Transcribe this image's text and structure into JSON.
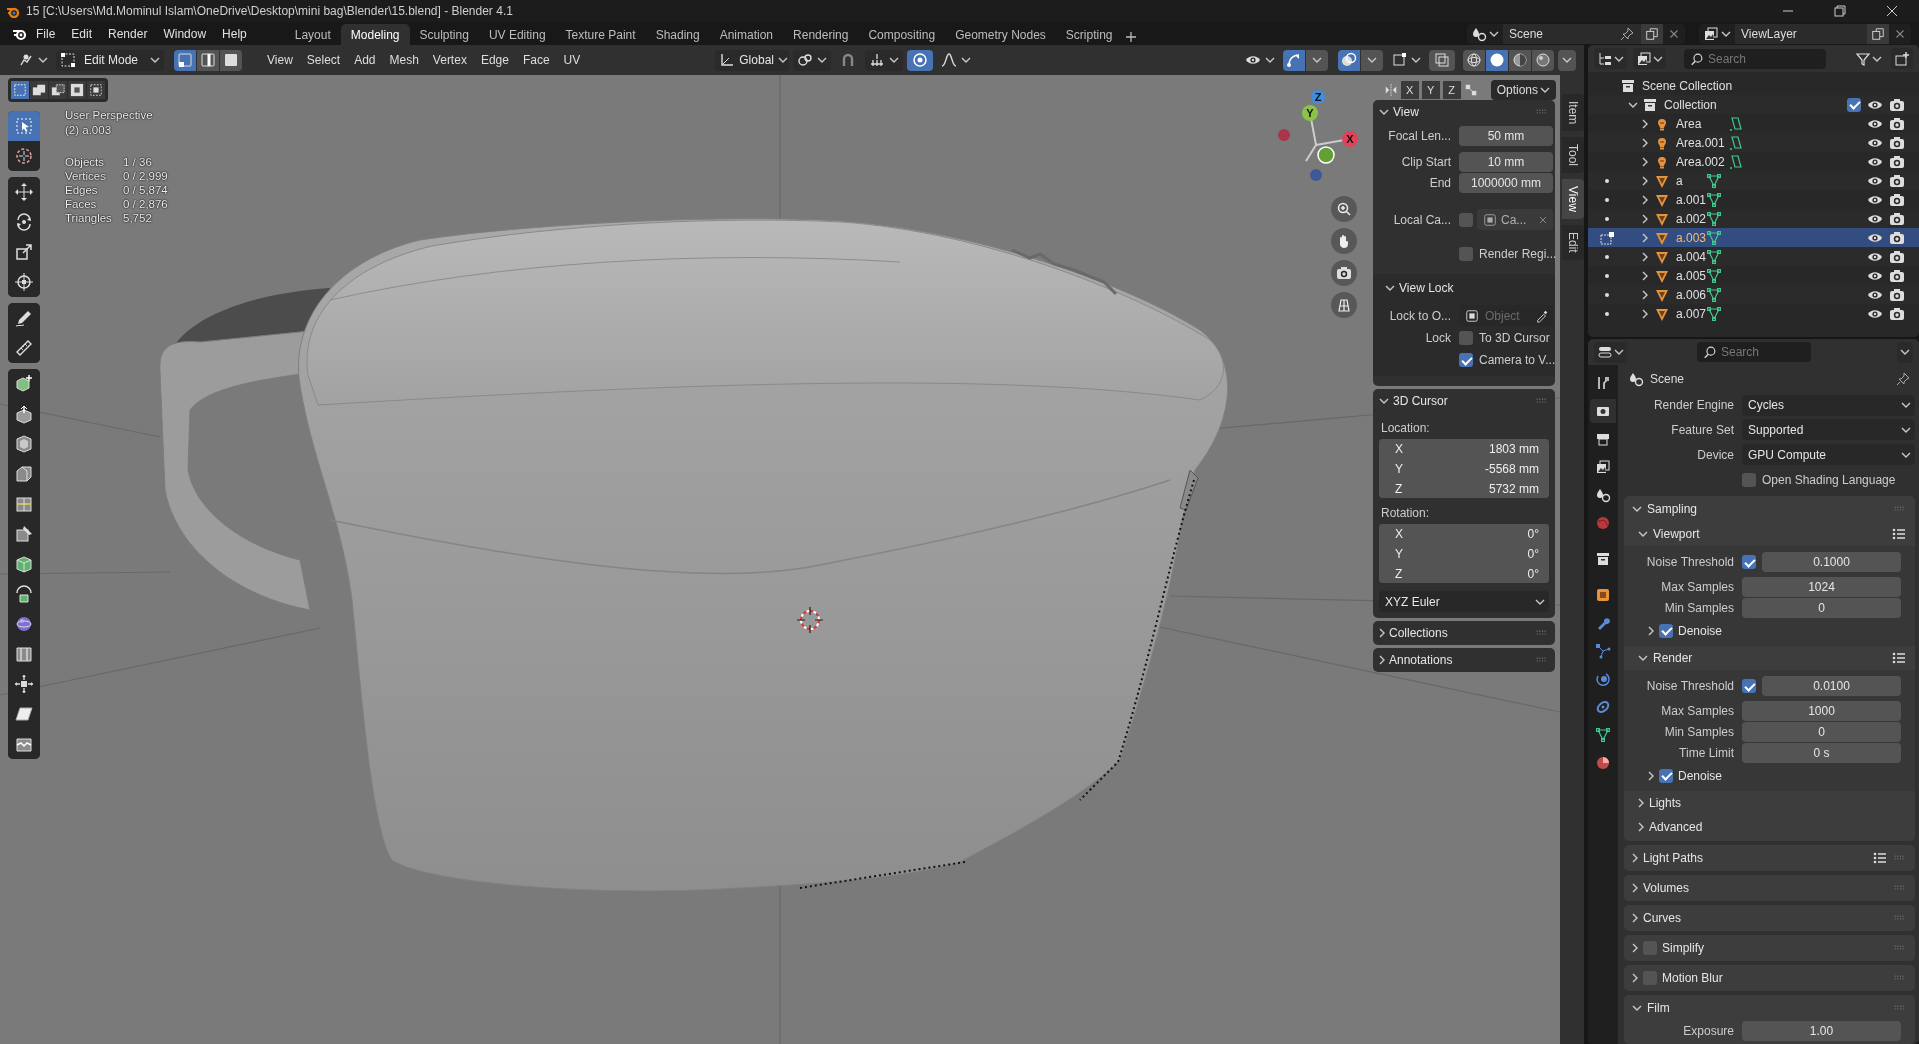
{
  "title_bar": {
    "title": "15 [C:\\Users\\Md.Mominul Islam\\OneDrive\\Desktop\\mini bag\\Blender\\15.blend] - Blender 4.1"
  },
  "menu": [
    "File",
    "Edit",
    "Render",
    "Window",
    "Help"
  ],
  "workspaces": [
    {
      "label": "Layout",
      "selected": false
    },
    {
      "label": "Modeling",
      "selected": true
    },
    {
      "label": "Sculpting",
      "selected": false
    },
    {
      "label": "UV Editing",
      "selected": false
    },
    {
      "label": "Texture Paint",
      "selected": false
    },
    {
      "label": "Shading",
      "selected": false
    },
    {
      "label": "Animation",
      "selected": false
    },
    {
      "label": "Rendering",
      "selected": false
    },
    {
      "label": "Compositing",
      "selected": false
    },
    {
      "label": "Geometry Nodes",
      "selected": false
    },
    {
      "label": "Scripting",
      "selected": false
    }
  ],
  "scene": {
    "name": "Scene"
  },
  "view_layer": {
    "name": "ViewLayer"
  },
  "viewport_header": {
    "mode": "Edit Mode",
    "select_modes": [
      {
        "kind": "vertex",
        "selected": true
      },
      {
        "kind": "edge",
        "selected": false
      },
      {
        "kind": "face",
        "selected": false
      }
    ],
    "menus": [
      "View",
      "Select",
      "Add",
      "Mesh",
      "Vertex",
      "Edge",
      "Face",
      "UV"
    ],
    "orientation": "Global",
    "proportional_editing": true,
    "gizmos": true,
    "overlays": true,
    "shading_modes": [
      {
        "kind": "wireframe",
        "selected": false
      },
      {
        "kind": "solid",
        "selected": true
      },
      {
        "kind": "material",
        "selected": false
      },
      {
        "kind": "rendered",
        "selected": false
      }
    ]
  },
  "viewport": {
    "select_box_modes": [
      {
        "kind": "set",
        "selected": true
      },
      {
        "kind": "extend",
        "selected": false
      },
      {
        "kind": "subtract",
        "selected": false
      },
      {
        "kind": "invert",
        "selected": false
      },
      {
        "kind": "intersect",
        "selected": false
      }
    ],
    "mirror_axes": [
      "X",
      "Y",
      "Z"
    ],
    "options": "Options",
    "view_name": "User Perspective",
    "active_object": "(2) a.003",
    "stats": [
      {
        "label": "Objects",
        "value": "1 / 36"
      },
      {
        "label": "Vertices",
        "value": "0 / 2,999"
      },
      {
        "label": "Edges",
        "value": "0 / 5,874"
      },
      {
        "label": "Faces",
        "value": "0 / 2,876"
      },
      {
        "label": "Triangles",
        "value": "5,752"
      }
    ],
    "gizmo_axes": [
      "X",
      "Y",
      "Z"
    ],
    "tools": [
      {
        "kind": "select_box",
        "selected": true
      },
      {
        "kind": "cursor",
        "selected": false
      },
      {
        "kind": "move",
        "selected": false
      },
      {
        "kind": "rotate",
        "selected": false
      },
      {
        "kind": "scale",
        "selected": false
      },
      {
        "kind": "transform",
        "selected": false
      },
      {
        "kind": "annotate",
        "selected": false
      },
      {
        "kind": "measure",
        "selected": false
      },
      {
        "kind": "add_cube",
        "selected": false
      },
      {
        "kind": "extrude",
        "selected": false
      },
      {
        "kind": "inset",
        "selected": false
      },
      {
        "kind": "bevel",
        "selected": false
      },
      {
        "kind": "loop_cut",
        "selected": false
      },
      {
        "kind": "knife",
        "selected": false
      },
      {
        "kind": "poly_build",
        "selected": false
      },
      {
        "kind": "spin",
        "selected": false
      },
      {
        "kind": "smooth",
        "selected": false
      },
      {
        "kind": "edge_slide",
        "selected": false
      },
      {
        "kind": "shrink_fatten",
        "selected": false
      },
      {
        "kind": "shear",
        "selected": false
      },
      {
        "kind": "rip",
        "selected": false
      }
    ]
  },
  "sidebar": {
    "tabs": [
      {
        "label": "Item",
        "selected": false
      },
      {
        "label": "Tool",
        "selected": false
      },
      {
        "label": "View",
        "selected": true
      },
      {
        "label": "Edit",
        "selected": false
      }
    ],
    "view_panel": {
      "title": "View",
      "expanded": true,
      "fields": [
        {
          "label": "Focal Len...",
          "value": "50 mm"
        },
        {
          "label": "Clip Start",
          "value": "10 mm"
        },
        {
          "label": "End",
          "value": "1000000 mm"
        }
      ],
      "local_camera": {
        "label": "Local Ca...",
        "checked": false,
        "value": "Ca..."
      },
      "render_region": {
        "label": "Render Regi...",
        "checked": false
      },
      "view_lock": {
        "title": "View Lock",
        "expanded": true,
        "lock_to_label": "Lock to O...",
        "lock_to_placeholder": "Object",
        "lock_label": "Lock",
        "options": [
          {
            "label": "To 3D Cursor",
            "checked": false
          },
          {
            "label": "Camera to V...",
            "checked": true
          }
        ]
      }
    },
    "cursor_panel": {
      "title": "3D Cursor",
      "expanded": true,
      "location_label": "Location:",
      "location": [
        {
          "axis": "X",
          "value": "1803 mm"
        },
        {
          "axis": "Y",
          "value": "-5568 mm"
        },
        {
          "axis": "Z",
          "value": "5732 mm"
        }
      ],
      "rotation_label": "Rotation:",
      "rotation": [
        {
          "axis": "X",
          "value": "0°"
        },
        {
          "axis": "Y",
          "value": "0°"
        },
        {
          "axis": "Z",
          "value": "0°"
        }
      ],
      "rotation_mode": "XYZ Euler"
    },
    "collapsed_panels": [
      {
        "title": "Collections",
        "expanded": false
      },
      {
        "title": "Annotations",
        "expanded": false
      }
    ]
  },
  "outliner": {
    "search": {
      "placeholder": "Search"
    },
    "root": "Scene Collection",
    "collection": {
      "name": "Collection",
      "expanded": true,
      "checked": true,
      "children": [
        {
          "name": "Area",
          "kind": "light",
          "selected": false
        },
        {
          "name": "Area.001",
          "kind": "light",
          "selected": false
        },
        {
          "name": "Area.002",
          "kind": "light",
          "selected": false
        },
        {
          "name": "a",
          "kind": "mesh",
          "selected": false
        },
        {
          "name": "a.001",
          "kind": "mesh",
          "selected": false
        },
        {
          "name": "a.002",
          "kind": "mesh",
          "selected": false
        },
        {
          "name": "a.003",
          "kind": "mesh",
          "selected": true
        },
        {
          "name": "a.004",
          "kind": "mesh",
          "selected": false
        },
        {
          "name": "a.005",
          "kind": "mesh",
          "selected": false
        },
        {
          "name": "a.006",
          "kind": "mesh",
          "selected": false
        },
        {
          "name": "a.007",
          "kind": "mesh",
          "selected": false
        }
      ]
    }
  },
  "properties": {
    "search": {
      "placeholder": "Search"
    },
    "tabs": [
      {
        "kind": "tool",
        "selected": false
      },
      {
        "kind": "render",
        "selected": true
      },
      {
        "kind": "output",
        "selected": false
      },
      {
        "kind": "view_layer",
        "selected": false
      },
      {
        "kind": "scene",
        "selected": false
      },
      {
        "kind": "world",
        "selected": false
      },
      {
        "kind": "collection",
        "selected": false
      },
      {
        "kind": "object",
        "selected": false
      },
      {
        "kind": "modifiers",
        "selected": false
      },
      {
        "kind": "particles",
        "selected": false
      },
      {
        "kind": "physics",
        "selected": false
      },
      {
        "kind": "constraints",
        "selected": false
      },
      {
        "kind": "data",
        "selected": false
      },
      {
        "kind": "material",
        "selected": false
      }
    ],
    "context": "Scene",
    "fields": [
      {
        "kind": "dropdown",
        "label": "Render Engine",
        "value": "Cycles"
      },
      {
        "kind": "dropdown",
        "label": "Feature Set",
        "value": "Supported"
      },
      {
        "kind": "dropdown",
        "label": "Device",
        "value": "GPU Compute"
      },
      {
        "kind": "checkbox",
        "label": "Open Shading Language",
        "checked": false
      }
    ],
    "panels": [
      {
        "title": "Sampling",
        "expanded": true,
        "items": [
          {
            "kind": "subpanel",
            "title": "Viewport",
            "expanded": true,
            "presets": true,
            "items": [
              {
                "kind": "check_number",
                "label": "Noise Threshold",
                "checked": true,
                "value": "0.1000"
              },
              {
                "kind": "number",
                "label": "Max Samples",
                "value": "1024"
              },
              {
                "kind": "number",
                "label": "Min Samples",
                "value": "0"
              },
              {
                "kind": "subpanel",
                "title": "Denoise",
                "expanded": false,
                "checked": true
              }
            ]
          },
          {
            "kind": "subpanel",
            "title": "Render",
            "expanded": true,
            "presets": true,
            "items": [
              {
                "kind": "check_number",
                "label": "Noise Threshold",
                "checked": true,
                "value": "0.0100"
              },
              {
                "kind": "number",
                "label": "Max Samples",
                "value": "1000"
              },
              {
                "kind": "number",
                "label": "Min Samples",
                "value": "0"
              },
              {
                "kind": "number",
                "label": "Time Limit",
                "value": "0 s"
              },
              {
                "kind": "subpanel",
                "title": "Denoise",
                "expanded": false,
                "checked": true
              }
            ]
          },
          {
            "kind": "subpanel",
            "title": "Lights",
            "expanded": false
          },
          {
            "kind": "subpanel",
            "title": "Advanced",
            "expanded": false
          }
        ]
      },
      {
        "title": "Light Paths",
        "expanded": false,
        "presets": true
      },
      {
        "title": "Volumes",
        "expanded": false
      },
      {
        "title": "Curves",
        "expanded": false
      },
      {
        "title": "Simplify",
        "expanded": false,
        "checked": false
      },
      {
        "title": "Motion Blur",
        "expanded": false,
        "checked": false
      },
      {
        "title": "Film",
        "expanded": true,
        "items": [
          {
            "kind": "number",
            "label": "Exposure",
            "value": "1.00"
          }
        ]
      }
    ]
  }
}
